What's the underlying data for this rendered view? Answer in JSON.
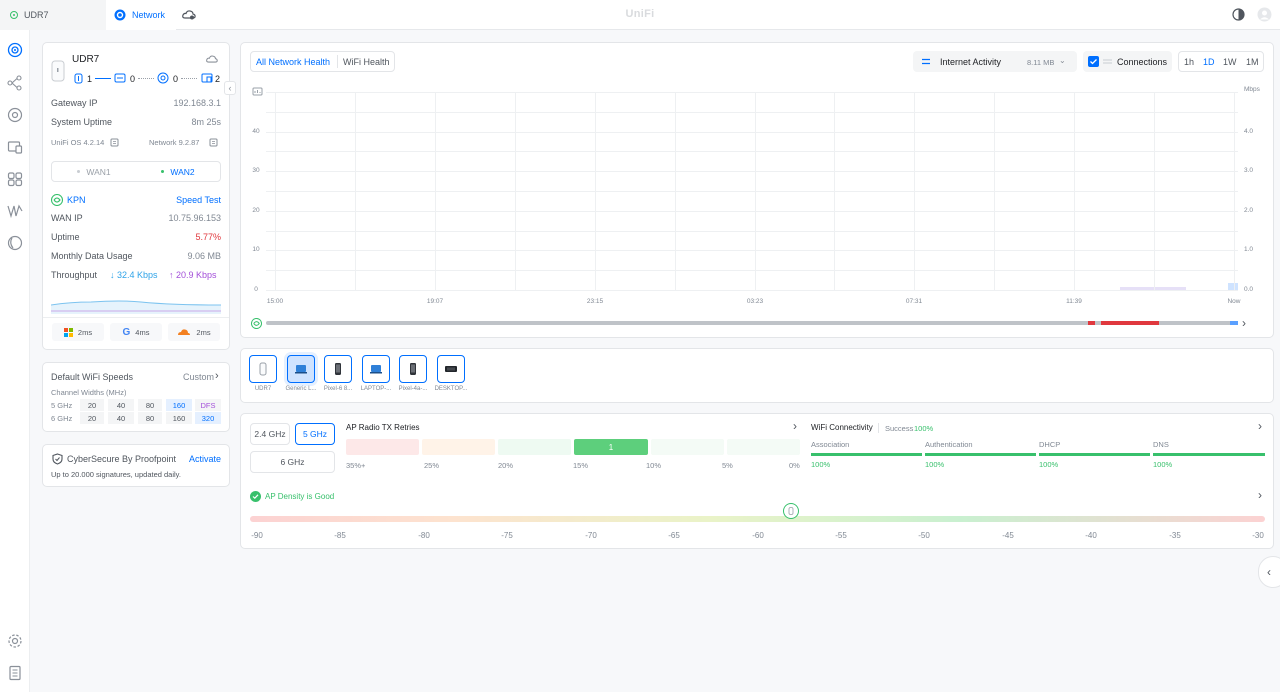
{
  "topbar": {
    "device_tab": "UDR7",
    "network_tab": "Network",
    "brand": "UniFi"
  },
  "left_nav_icons": [
    "dashboard-icon",
    "topology-icon",
    "devices-icon",
    "clients-icon",
    "insights-icon",
    "statistics-icon",
    "vpn-icon",
    "settings-icon",
    "logs-icon"
  ],
  "gateway": {
    "name": "UDR7",
    "counts": [
      "1",
      "0",
      "0",
      "2"
    ],
    "gateway_ip_label": "Gateway IP",
    "gateway_ip": "192.168.3.1",
    "uptime_label": "System Uptime",
    "uptime": "8m 25s",
    "os_version": "UniFi OS 4.2.14",
    "network_version": "Network 9.2.87",
    "wan_tabs": [
      "WAN1",
      "WAN2"
    ],
    "isp": "KPN",
    "speed_test": "Speed Test",
    "wan_ip_label": "WAN IP",
    "wan_ip": "10.75.96.153",
    "wan_uptime_label": "Uptime",
    "wan_uptime": "5.77%",
    "monthly_label": "Monthly Data Usage",
    "monthly": "9.06 MB",
    "throughput_label": "Throughput",
    "down": "32.4 Kbps",
    "up": "20.9 Kbps",
    "latency": [
      {
        "icon": "microsoft-icon",
        "value": "2ms"
      },
      {
        "icon": "google-icon",
        "value": "4ms"
      },
      {
        "icon": "cloudflare-icon",
        "value": "2ms"
      }
    ]
  },
  "wifi_speeds": {
    "title": "Default WiFi Speeds",
    "custom": "Custom",
    "subtitle": "Channel Widths (MHz)",
    "rows": [
      {
        "band": "5 GHz",
        "values": [
          "20",
          "40",
          "80",
          "160",
          "DFS"
        ]
      },
      {
        "band": "6 GHz",
        "values": [
          "20",
          "40",
          "80",
          "160",
          "320"
        ]
      }
    ]
  },
  "cybersecure": {
    "title": "CyberSecure By Proofpoint",
    "action": "Activate",
    "desc": "Up to 20.000 signatures, updated daily."
  },
  "chart_toolbar": {
    "tabs": [
      "All Network Health",
      "WiFi Health"
    ],
    "metric": "Internet Activity",
    "metric_value": "8.11 MB",
    "connections": "Connections",
    "ranges": [
      "1h",
      "1D",
      "1W",
      "1M"
    ],
    "active_range": "1D"
  },
  "chart_data": {
    "type": "area",
    "x_ticks": [
      "15:00",
      "19:07",
      "23:15",
      "03:23",
      "07:31",
      "11:39",
      "Now"
    ],
    "left_ticks": [
      "40",
      "30",
      "20",
      "10",
      "0"
    ],
    "right_unit": "Mbps",
    "right_ticks": [
      "4.0",
      "3.0",
      "2.0",
      "1.0",
      "0.0"
    ],
    "left_ylim": [
      0,
      50
    ],
    "right_ylim": [
      0,
      5
    ],
    "grid": true,
    "series": [
      {
        "values": [
          0,
          0,
          0,
          0,
          0,
          0,
          0.02
        ]
      }
    ],
    "colors": {
      "accent": "#006fff",
      "timeline_ok": "#bfc3c8",
      "timeline_bad": "#e0383e"
    }
  },
  "devices": [
    {
      "label": "UDR7",
      "icon": "router-icon"
    },
    {
      "label": "Generic L...",
      "icon": "laptop-icon"
    },
    {
      "label": "Pixel-6 8...",
      "icon": "phone-icon"
    },
    {
      "label": "LAPTOP-...",
      "icon": "laptop-icon"
    },
    {
      "label": "Pixel-4a-...",
      "icon": "phone-icon"
    },
    {
      "label": "DESKTOP...",
      "icon": "desktop-icon"
    }
  ],
  "radio": {
    "bands": [
      "2.4 GHz",
      "5 GHz",
      "6 GHz"
    ],
    "active_band": "5 GHz",
    "retries_title": "AP Radio TX Retries",
    "retry_labels": [
      "35%+",
      "25%",
      "20%",
      "15%",
      "10%",
      "5%",
      "0%"
    ],
    "retry_value": "1",
    "wifi_title": "WiFi Connectivity",
    "success_label": "Success",
    "success_value": "100%",
    "phases": [
      {
        "name": "Association",
        "value": "100%"
      },
      {
        "name": "Authentication",
        "value": "100%"
      },
      {
        "name": "DHCP",
        "value": "100%"
      },
      {
        "name": "DNS",
        "value": "100%"
      }
    ],
    "density_title": "AP Density is Good",
    "density_labels": [
      "-90",
      "-85",
      "-80",
      "-75",
      "-70",
      "-65",
      "-60",
      "-55",
      "-50",
      "-45",
      "-40",
      "-35",
      "-30"
    ],
    "density_value": -58
  }
}
